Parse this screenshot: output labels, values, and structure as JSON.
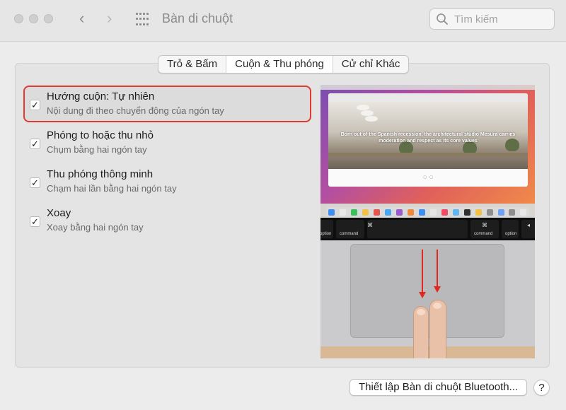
{
  "window": {
    "title": "Bàn di chuột",
    "back_glyph": "‹",
    "forward_glyph": "›"
  },
  "search": {
    "placeholder": "Tìm kiếm"
  },
  "tabs": [
    {
      "label": "Trỏ & Bấm",
      "active": false
    },
    {
      "label": "Cuộn & Thu phóng",
      "active": true
    },
    {
      "label": "Cử chỉ Khác",
      "active": false
    }
  ],
  "options": [
    {
      "title": "Hướng cuộn: Tự nhiên",
      "subtitle": "Nội dung đi theo chuyển động của ngón tay",
      "checked": true,
      "highlighted": true
    },
    {
      "title": "Phóng to hoặc thu nhỏ",
      "subtitle": "Chụm bằng hai ngón tay",
      "checked": true,
      "highlighted": false
    },
    {
      "title": "Thu phóng thông minh",
      "subtitle": "Chạm hai lần bằng hai ngón tay",
      "checked": true,
      "highlighted": false
    },
    {
      "title": "Xoay",
      "subtitle": "Xoay bằng hai ngón tay",
      "checked": true,
      "highlighted": false
    }
  ],
  "illustration": {
    "caption": "Born out of the Spanish recession, the architectural studio Mesura carries moderation and respect as its core values",
    "keys": {
      "option_left": "option",
      "command_left": "command",
      "command_right": "command",
      "option_right": "option",
      "command_symbol": "⌘"
    }
  },
  "bottom": {
    "bluetooth_button": "Thiết lập Bàn di chuột Bluetooth...",
    "help": "?"
  },
  "colors": {
    "highlight_border": "#e23a32",
    "arrow": "#e0281f",
    "window_bg": "#ececec"
  }
}
